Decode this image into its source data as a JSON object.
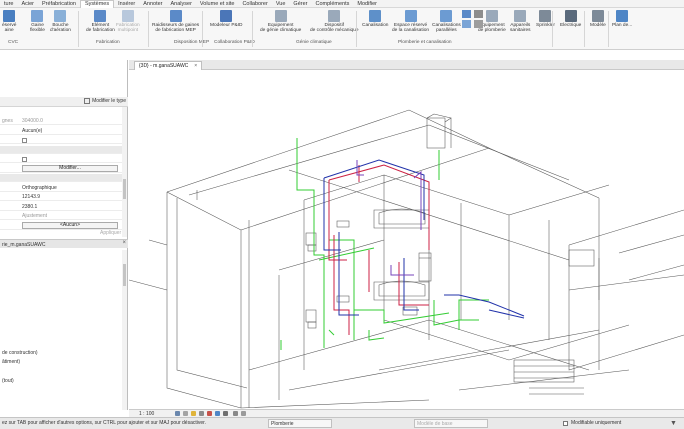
{
  "menu": [
    "ture",
    "Acier",
    "Préfabrication",
    "Systèmes",
    "Insérer",
    "Annoter",
    "Analyser",
    "Volume et site",
    "Collaborer",
    "Vue",
    "Gérer",
    "Compléments",
    "Modifier"
  ],
  "menu_active_index": 3,
  "ribbon": {
    "buttons": [
      {
        "label": "éservé\naine",
        "color": "#4a7fc1",
        "dim": false
      },
      {
        "label": "Gaine\nflexible",
        "color": "#7aa4d6",
        "dim": false
      },
      {
        "label": "Bouche\nd'aération",
        "color": "#8ab0d8",
        "dim": false
      },
      {
        "label": "Elément\nde fabrication",
        "color": "#5b8ac8",
        "dim": false
      },
      {
        "label": "Fabrication\nmultipoint",
        "color": "#b8c8dc",
        "dim": true
      },
      {
        "label": "Raidisseurs de gaines\nde fabrication MEP",
        "color": "#5b8ac8",
        "dim": false
      },
      {
        "label": "Modeleur P&ID",
        "color": "#4b76b8",
        "dim": false
      },
      {
        "label": "Equipement\nde génie climatique",
        "color": "#9aa9ba",
        "dim": false
      },
      {
        "label": "Dispositif\nde contrôle mécanique",
        "color": "#9aa9ba",
        "dim": false
      },
      {
        "label": "Canalisation",
        "color": "#5e90c9",
        "dim": false
      },
      {
        "label": "Espace réservé\nde la canalisation",
        "color": "#6c9bd2",
        "dim": false
      },
      {
        "label": "Canalisations\nparallèles",
        "color": "#6c9bd2",
        "dim": false
      },
      {
        "label": "Equipement\nde plomberie",
        "color": "#9aa9ba",
        "dim": false
      },
      {
        "label": "Appareils\nsanitaires",
        "color": "#9aa9ba",
        "dim": false
      },
      {
        "label": "Sprinkler",
        "color": "#7d8a98",
        "dim": false
      },
      {
        "label": "Electrique",
        "color": "#5a6a7c",
        "dim": false
      },
      {
        "label": "Modèle",
        "color": "#7d8a98",
        "dim": false
      },
      {
        "label": "Plan de...",
        "color": "#4f86c6",
        "dim": false
      }
    ],
    "groups": [
      "CVC",
      "Fabrication",
      "Disposition MEP",
      "Collaboration P&ID",
      "Génie climatique",
      "Plomberie et canalisation"
    ]
  },
  "properties": {
    "modify_type": "Modifier le type",
    "rows": [
      {
        "key": "gnes",
        "value": "304000.0",
        "gray": true
      },
      {
        "key": "",
        "value": "Aucun(e)",
        "gray": false
      },
      {
        "key": "",
        "value": "",
        "checkbox": true
      },
      {
        "key": "",
        "value": "",
        "group": true
      },
      {
        "key": "",
        "value": "",
        "checkbox": true
      },
      {
        "key": "",
        "value": "Modifier...",
        "button": true
      },
      {
        "key": "",
        "value": "",
        "group": true
      },
      {
        "key": "",
        "value": "Orthographique",
        "gray": false
      },
      {
        "key": "",
        "value": "12143.9",
        "gray": false
      },
      {
        "key": "",
        "value": "2380.1",
        "gray": false
      },
      {
        "key": "",
        "value": "Ajustement",
        "gray": true
      },
      {
        "key": "",
        "value": "<Aucun>",
        "button": true
      }
    ],
    "apply": "Appliquer"
  },
  "browser": {
    "title": "rie_m.ganaSUAWC",
    "close": "×",
    "items": [
      "de construction)",
      "âtiment)",
      "(tout)"
    ]
  },
  "view": {
    "tab_label": "{3D} - m.ganaSUAWC",
    "tab_close": "×",
    "scale": "1 : 100"
  },
  "status": {
    "hint": "ez sur TAB pour afficher d'autres options, sur CTRL pour ajouter et sur MAJ pour désactiver.",
    "system": "Plomberie",
    "model": "Modèle de base",
    "editable_only": "Modifiable uniquement"
  },
  "colors": {
    "pipe_green": "#33cc33",
    "pipe_red": "#cc2244",
    "pipe_blue": "#2233aa",
    "pipe_purple": "#7744bb",
    "accent_blue": "#2d6db5"
  }
}
